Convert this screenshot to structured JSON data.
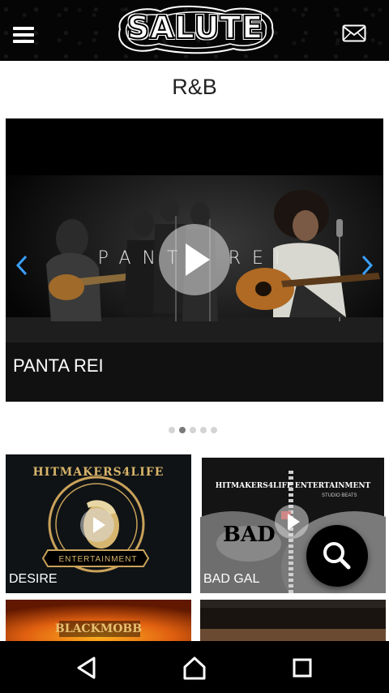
{
  "header": {
    "logo_text": "SALUTE",
    "menu_icon": "hamburger-menu-icon",
    "mail_icon": "envelope-icon"
  },
  "section": {
    "title": "R&B"
  },
  "carousel": {
    "slide_title": "PANTA REI",
    "overlay_title": "PANTA REI",
    "dot_count": 5,
    "active_dot": 1
  },
  "tiles": [
    {
      "label": "DESIRE",
      "art_text_top": "HITMAKERS4LIFE",
      "art_text_bottom": "ENTERTAINMENT"
    },
    {
      "label": "BAD GAL",
      "art_text_top": "HITMAKERS4LIFE ENTERTAINMENT",
      "art_text_small": "STUDIO BEATS",
      "art_text_big": "BAD"
    },
    {
      "label": "",
      "art_text_top": "BLACKMOBB"
    },
    {
      "label": ""
    }
  ],
  "fab": {
    "icon": "search-icon"
  },
  "navbar": {
    "back_icon": "back-triangle-icon",
    "home_icon": "home-icon",
    "recents_icon": "recents-square-icon"
  },
  "colors": {
    "header_bg": "#050505",
    "nav_bg": "#000000",
    "active_dot": "#7a7a7a",
    "inactive_dot": "#d4d4d4"
  }
}
